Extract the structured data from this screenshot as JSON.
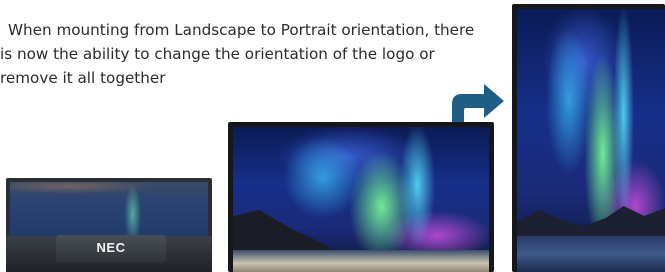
{
  "description": {
    "line1": "When mounting from Landscape to Portrait orientation, there",
    "line2": "is now the ability to change the orientation of the logo or",
    "line3": "remove it all together"
  },
  "logo": {
    "text": "NEC"
  },
  "arrow": {
    "icon": "curved-arrow-right-icon",
    "color": "#1f5f86"
  },
  "colors": {
    "text": "#2b2b2b",
    "bezel": "#2a2e35"
  }
}
